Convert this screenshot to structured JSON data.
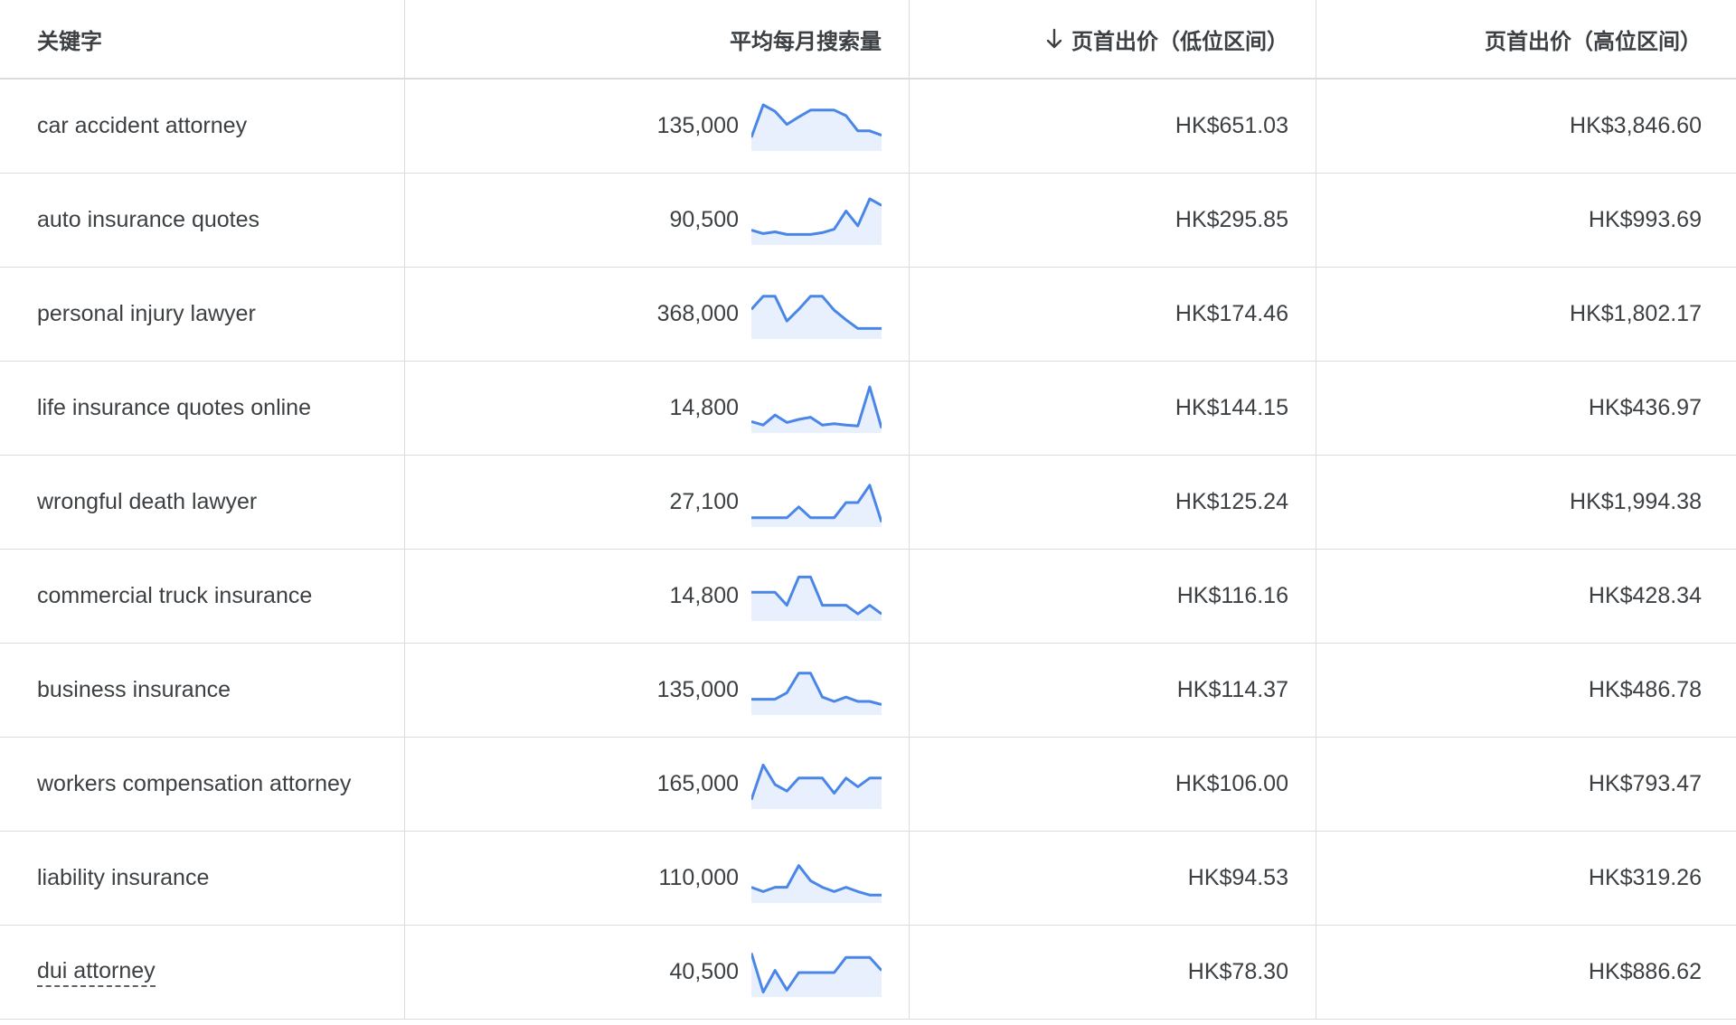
{
  "header": {
    "keyword": "关键字",
    "avg_monthly": "平均每月搜索量",
    "bid_low": "页首出价（低位区间）",
    "bid_high": "页首出价（高位区间）",
    "sort_icon": "arrow-down-icon"
  },
  "colors": {
    "sparkline": "#4a86e8",
    "sparkfill": "#e8f0fd",
    "grid": "#dadce0",
    "text": "#3c4043"
  },
  "rows": [
    {
      "keyword": "car accident attorney",
      "volume": "135,000",
      "bid_low": "HK$651.03",
      "bid_high": "HK$3,846.60",
      "trend": [
        0.25,
        1.0,
        0.85,
        0.55,
        0.72,
        0.88,
        0.88,
        0.88,
        0.75,
        0.4,
        0.4,
        0.3
      ]
    },
    {
      "keyword": "auto insurance quotes",
      "volume": "90,500",
      "bid_low": "HK$295.85",
      "bid_high": "HK$993.69",
      "trend": [
        0.28,
        0.2,
        0.24,
        0.18,
        0.18,
        0.18,
        0.22,
        0.3,
        0.72,
        0.38,
        1.0,
        0.85
      ]
    },
    {
      "keyword": "personal injury lawyer",
      "volume": "368,000",
      "bid_low": "HK$174.46",
      "bid_high": "HK$1,802.17",
      "trend": [
        0.62,
        0.92,
        0.92,
        0.35,
        0.62,
        0.92,
        0.92,
        0.6,
        0.38,
        0.18,
        0.18,
        0.18
      ]
    },
    {
      "keyword": "life insurance quotes online",
      "volume": "14,800",
      "bid_low": "HK$144.15",
      "bid_high": "HK$436.97",
      "trend": [
        0.2,
        0.12,
        0.35,
        0.18,
        0.25,
        0.3,
        0.12,
        0.15,
        0.12,
        0.1,
        1.0,
        0.05
      ]
    },
    {
      "keyword": "wrongful death lawyer",
      "volume": "27,100",
      "bid_low": "HK$125.24",
      "bid_high": "HK$1,994.38",
      "trend": [
        0.15,
        0.15,
        0.15,
        0.15,
        0.4,
        0.15,
        0.15,
        0.15,
        0.5,
        0.5,
        0.9,
        0.05
      ]
    },
    {
      "keyword": "commercial truck insurance",
      "volume": "14,800",
      "bid_low": "HK$116.16",
      "bid_high": "HK$428.34",
      "trend": [
        0.6,
        0.6,
        0.6,
        0.3,
        0.95,
        0.95,
        0.3,
        0.3,
        0.3,
        0.1,
        0.3,
        0.1
      ]
    },
    {
      "keyword": "business insurance",
      "volume": "135,000",
      "bid_low": "HK$114.37",
      "bid_high": "HK$486.78",
      "trend": [
        0.3,
        0.3,
        0.3,
        0.45,
        0.9,
        0.9,
        0.35,
        0.25,
        0.35,
        0.25,
        0.25,
        0.18
      ]
    },
    {
      "keyword": "workers compensation attorney",
      "volume": "165,000",
      "bid_low": "HK$106.00",
      "bid_high": "HK$793.47",
      "trend": [
        0.15,
        0.95,
        0.5,
        0.35,
        0.65,
        0.65,
        0.65,
        0.3,
        0.65,
        0.45,
        0.65,
        0.65
      ]
    },
    {
      "keyword": "liability insurance",
      "volume": "110,000",
      "bid_low": "HK$94.53",
      "bid_high": "HK$319.26",
      "trend": [
        0.3,
        0.2,
        0.3,
        0.3,
        0.8,
        0.45,
        0.3,
        0.2,
        0.3,
        0.2,
        0.12,
        0.12
      ]
    },
    {
      "keyword": "dui attorney",
      "volume": "40,500",
      "bid_low": "HK$78.30",
      "bid_high": "HK$886.62",
      "trend": [
        0.95,
        0.05,
        0.55,
        0.1,
        0.5,
        0.5,
        0.5,
        0.5,
        0.85,
        0.85,
        0.85,
        0.55
      ]
    }
  ]
}
